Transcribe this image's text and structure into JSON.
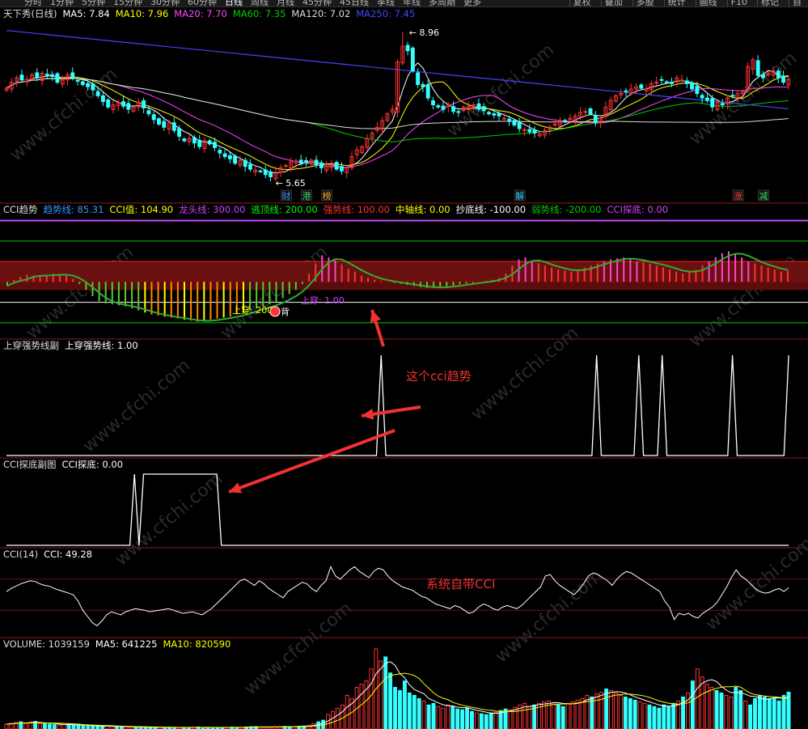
{
  "topbar": {
    "tabs": [
      "分时",
      "1分钟",
      "5分钟",
      "15分钟",
      "30分钟",
      "60分钟",
      "日线",
      "周线",
      "月线",
      "45分钟",
      "45日线",
      "季线",
      "年线",
      "多周期",
      "更多"
    ],
    "active_tab": "日线",
    "tools": [
      "复权",
      "叠加",
      "多股",
      "统计",
      "画线",
      "F10",
      "标记",
      "自"
    ]
  },
  "panels": {
    "main": {
      "header": [
        {
          "text": "天下秀(日线)",
          "color": "#dddddd"
        },
        {
          "text": "MA5: 7.84",
          "color": "#ffffff"
        },
        {
          "text": "MA10: 7.96",
          "color": "#ffff00"
        },
        {
          "text": "MA20: 7.70",
          "color": "#ff44ff"
        },
        {
          "text": "MA60: 7.35",
          "color": "#00cc00"
        },
        {
          "text": "MA120: 7.02",
          "color": "#dddddd"
        },
        {
          "text": "MA250: 7.45",
          "color": "#4444ff"
        }
      ],
      "high_label": "8.96",
      "low_label": "5.65",
      "event_markers": [
        {
          "text": "财",
          "color": "#3399ff"
        },
        {
          "text": "港",
          "color": "#33dd66"
        },
        {
          "text": "榜",
          "color": "#ffaa33"
        },
        {
          "text": "解",
          "color": "#33ccff"
        },
        {
          "text": "涨",
          "color": "#ff4444"
        },
        {
          "text": "减",
          "color": "#33dd66"
        }
      ]
    },
    "cci_trend": {
      "header": [
        {
          "text": "CCI趋势",
          "color": "#dddddd"
        },
        {
          "text": "趋势线: 85.31",
          "color": "#3399ff"
        },
        {
          "text": "CCI值: 104.90",
          "color": "#ffff00"
        },
        {
          "text": "龙头线: 300.00",
          "color": "#cc44ff"
        },
        {
          "text": "逃顶线: 200.00",
          "color": "#00ff00"
        },
        {
          "text": "强势线: 100.00",
          "color": "#ff3333"
        },
        {
          "text": "中轴线: 0.00",
          "color": "#ffff00"
        },
        {
          "text": "抄底线: -100.00",
          "color": "#ffffff"
        },
        {
          "text": "弱势线: -200.00",
          "color": "#00cc00"
        },
        {
          "text": "CCI探底: 0.00",
          "color": "#cc44ff"
        }
      ],
      "annotations": [
        "上穿: 200",
        "上穿: 1.00",
        "背"
      ]
    },
    "cross_sub": {
      "header": [
        {
          "text": "上穿强势线副",
          "color": "#dddddd"
        },
        {
          "text": "上穿强势线: 1.00",
          "color": "#ffffff"
        }
      ]
    },
    "bottom_sub": {
      "header": [
        {
          "text": "CCI探底副图",
          "color": "#dddddd"
        },
        {
          "text": "CCI探底: 0.00",
          "color": "#ffffff"
        }
      ]
    },
    "cci14": {
      "header": [
        {
          "text": "CCI(14)",
          "color": "#dddddd"
        },
        {
          "text": "CCI: 49.28",
          "color": "#ffffff"
        }
      ]
    },
    "volume": {
      "header": [
        {
          "text": "VOLUME: 1039159",
          "color": "#dddddd"
        },
        {
          "text": "MA5: 641225",
          "color": "#ffffff"
        },
        {
          "text": "MA10: 820590",
          "color": "#ffff00"
        }
      ]
    }
  },
  "callouts": {
    "trend": "这个cci趋势",
    "builtin": "系统自带CCI"
  },
  "watermark": "www.cfchi.com",
  "colors": {
    "up": "#ff3333",
    "down": "#33ffff",
    "ma5": "#ffffff",
    "ma10": "#ffff00",
    "ma20": "#ff44ff",
    "ma60": "#00cc00",
    "ma120": "#dddddd",
    "ma250": "#4444ff",
    "arrow": "#ee3333"
  },
  "chart_data": [
    {
      "type": "candlestick",
      "title": "天下秀(日线)",
      "ylim": [
        5.4,
        9.3
      ],
      "close": [
        7.72,
        7.85,
        7.95,
        7.9,
        7.92,
        8.02,
        7.95,
        8.05,
        8.0,
        7.98,
        7.85,
        7.9,
        8.02,
        7.95,
        7.88,
        7.8,
        7.75,
        7.68,
        7.55,
        7.42,
        7.3,
        7.35,
        7.4,
        7.32,
        7.25,
        7.3,
        7.4,
        7.28,
        7.15,
        7.02,
        6.92,
        6.85,
        6.95,
        6.78,
        6.65,
        6.55,
        6.6,
        6.5,
        6.42,
        6.55,
        6.48,
        6.4,
        6.28,
        6.2,
        6.15,
        6.05,
        6.12,
        5.98,
        5.92,
        5.9,
        5.88,
        5.8,
        5.75,
        5.85,
        5.95,
        6.0,
        6.08,
        6.1,
        6.05,
        6.08,
        6.12,
        6.02,
        5.95,
        5.98,
        6.05,
        5.92,
        5.88,
        5.95,
        6.2,
        6.35,
        6.42,
        6.6,
        6.72,
        6.85,
        7.0,
        7.15,
        7.25,
        8.3,
        8.65,
        8.55,
        8.1,
        7.8,
        7.75,
        7.5,
        7.35,
        7.3,
        7.25,
        7.35,
        7.2,
        7.18,
        7.3,
        7.32,
        7.35,
        7.25,
        7.22,
        7.15,
        7.12,
        7.1,
        7.05,
        6.98,
        6.9,
        6.82,
        6.8,
        6.75,
        6.72,
        6.7,
        6.78,
        6.85,
        6.92,
        7.0,
        6.98,
        7.05,
        7.1,
        7.18,
        7.2,
        7.15,
        6.95,
        7.05,
        7.3,
        7.45,
        7.55,
        7.6,
        7.65,
        7.7,
        7.75,
        7.72,
        7.7,
        7.82,
        7.85,
        7.9,
        7.85,
        7.82,
        7.95,
        7.9,
        7.82,
        7.7,
        7.6,
        7.5,
        7.45,
        7.3,
        7.4,
        7.35,
        7.5,
        7.55,
        7.6,
        7.65,
        8.2,
        8.35,
        8.0,
        7.95,
        8.05,
        8.1,
        7.95,
        7.85,
        7.92
      ],
      "overlays": [
        "MA5",
        "MA10",
        "MA20",
        "MA60",
        "MA120",
        "MA250"
      ],
      "annotations": {
        "high": 8.96,
        "low": 5.65
      }
    },
    {
      "type": "bar",
      "title": "CCI趋势",
      "reference_lines": {
        "龙头线": 300,
        "逃顶线": 200,
        "强势线": 100,
        "中轴线": 0,
        "抄底线": -100,
        "弱势线": -200
      },
      "ylim": [
        -260,
        330
      ],
      "values": [
        -20,
        10,
        25,
        35,
        30,
        28,
        32,
        40,
        38,
        30,
        15,
        -10,
        -40,
        -70,
        -95,
        -105,
        -110,
        -115,
        -120,
        -130,
        -140,
        -150,
        -160,
        -165,
        -170,
        -175,
        -180,
        -185,
        -190,
        -195,
        -190,
        -185,
        -180,
        -175,
        -170,
        -160,
        -150,
        -140,
        -130,
        -120,
        -110,
        -100,
        -80,
        -60,
        -40,
        -10,
        40,
        90,
        130,
        120,
        105,
        85,
        65,
        50,
        30,
        20,
        10,
        5,
        0,
        -5,
        -10,
        -15,
        -20,
        -25,
        -30,
        -28,
        -26,
        -22,
        -18,
        -12,
        -8,
        -5,
        0,
        5,
        10,
        20,
        40,
        80,
        110,
        120,
        100,
        90,
        80,
        70,
        60,
        55,
        50,
        60,
        70,
        80,
        90,
        100,
        110,
        115,
        120,
        110,
        100,
        95,
        90,
        80,
        70,
        60,
        50,
        40,
        50,
        60,
        80,
        100,
        120,
        140,
        150,
        140,
        120,
        100,
        90,
        80,
        70,
        60,
        50,
        55
      ],
      "up_cross_value": 200
    },
    {
      "type": "line",
      "title": "上穿强势线副",
      "ylim": [
        0,
        1
      ],
      "values": [
        0,
        0,
        0,
        0,
        0,
        0,
        0,
        0,
        0,
        0,
        0,
        0,
        0,
        0,
        0,
        0,
        0,
        0,
        0,
        0,
        0,
        0,
        0,
        0,
        0,
        0,
        0,
        0,
        0,
        0,
        0,
        0,
        0,
        0,
        0,
        0,
        0,
        0,
        0,
        0,
        0,
        0,
        0,
        0,
        0,
        0,
        0,
        0,
        0,
        0,
        0,
        0,
        0,
        0,
        0,
        0,
        0,
        0,
        0,
        0,
        0,
        0,
        0,
        0,
        0,
        0,
        0,
        0,
        0,
        0,
        0,
        0,
        0,
        0,
        0,
        0,
        0,
        0,
        0,
        0,
        1,
        0,
        0,
        0,
        0,
        0,
        0,
        0,
        0,
        0,
        0,
        0,
        0,
        0,
        0,
        0,
        0,
        0,
        0,
        0,
        0,
        0,
        0,
        0,
        0,
        0,
        0,
        0,
        0,
        0,
        0,
        0,
        0,
        0,
        0,
        0,
        0,
        0,
        0,
        0,
        0,
        0,
        0,
        0,
        0,
        0,
        1,
        0,
        0,
        0,
        0,
        0,
        0,
        0,
        0,
        1,
        0,
        0,
        0,
        0,
        1,
        0,
        0,
        0,
        0,
        0,
        0,
        0,
        0,
        0,
        0,
        0,
        0,
        0,
        0,
        1,
        0,
        0,
        0,
        0,
        0,
        0,
        0,
        0,
        0,
        0,
        0,
        1
      ]
    },
    {
      "type": "line",
      "title": "CCI探底副图",
      "ylim": [
        0,
        1
      ],
      "values": [
        0,
        0,
        0,
        0,
        0,
        0,
        0,
        0,
        0,
        0,
        0,
        0,
        0,
        0,
        0,
        0,
        0,
        0,
        0,
        0,
        0,
        0,
        0,
        0,
        0,
        0,
        0,
        0,
        1,
        0,
        1,
        1,
        1,
        1,
        1,
        1,
        1,
        1,
        1,
        1,
        1,
        1,
        1,
        1,
        1,
        1,
        1,
        0,
        0,
        0,
        0,
        0,
        0,
        0,
        0,
        0,
        0,
        0,
        0,
        0,
        0,
        0,
        0,
        0,
        0,
        0,
        0,
        0,
        0,
        0,
        0,
        0,
        0,
        0,
        0,
        0,
        0,
        0,
        0,
        0,
        0,
        0,
        0,
        0,
        0,
        0,
        0,
        0,
        0,
        0,
        0,
        0,
        0,
        0,
        0,
        0,
        0,
        0,
        0,
        0,
        0,
        0,
        0,
        0,
        0,
        0,
        0,
        0,
        0,
        0,
        0,
        0,
        0,
        0,
        0,
        0,
        0,
        0,
        0,
        0,
        0,
        0,
        0,
        0,
        0,
        0,
        0,
        0,
        0,
        0,
        0,
        0,
        0,
        0,
        0,
        0,
        0,
        0,
        0,
        0,
        0,
        0,
        0,
        0,
        0,
        0,
        0,
        0,
        0,
        0,
        0,
        0,
        0,
        0,
        0,
        0,
        0,
        0,
        0,
        0,
        0,
        0,
        0,
        0,
        0,
        0,
        0,
        0,
        0,
        0,
        0,
        0
      ]
    },
    {
      "type": "line",
      "title": "CCI(14)",
      "ylim": [
        -250,
        250
      ],
      "values": [
        20,
        40,
        55,
        70,
        80,
        90,
        85,
        70,
        60,
        55,
        40,
        30,
        20,
        10,
        0,
        -40,
        -100,
        -140,
        -180,
        -200,
        -170,
        -130,
        -110,
        -120,
        -130,
        -110,
        -100,
        -90,
        -95,
        -100,
        -110,
        -105,
        -100,
        -95,
        -90,
        -100,
        -110,
        -120,
        -115,
        -110,
        -120,
        -130,
        -110,
        -90,
        -60,
        -30,
        0,
        30,
        60,
        90,
        100,
        80,
        60,
        90,
        70,
        40,
        20,
        0,
        -20,
        20,
        40,
        60,
        80,
        70,
        40,
        20,
        60,
        90,
        180,
        120,
        100,
        130,
        160,
        180,
        150,
        130,
        110,
        150,
        170,
        160,
        120,
        90,
        70,
        50,
        40,
        30,
        10,
        -10,
        -20,
        -40,
        -60,
        -70,
        -80,
        -90,
        -70,
        -80,
        -100,
        -120,
        -110,
        -80,
        -60,
        -70,
        -90,
        -100,
        -80,
        -70,
        -80,
        -90,
        -70,
        -40,
        -10,
        20,
        50,
        120,
        130,
        90,
        60,
        40,
        20,
        0,
        30,
        70,
        120,
        140,
        130,
        110,
        90,
        60,
        100,
        130,
        150,
        140,
        120,
        100,
        80,
        60,
        40,
        20,
        -40,
        -80,
        -160,
        -120,
        -130,
        -120,
        -140,
        -150,
        -120,
        -100,
        -80,
        -50,
        0,
        50,
        110,
        160,
        120,
        100,
        70,
        40,
        20,
        10,
        15,
        30,
        40,
        20,
        45
      ]
    },
    {
      "type": "bar",
      "title": "VOLUME",
      "values": [
        60,
        70,
        80,
        90,
        70,
        85,
        95,
        70,
        65,
        60,
        55,
        50,
        55,
        60,
        50,
        45,
        40,
        42,
        38,
        35,
        30,
        35,
        32,
        30,
        28,
        26,
        24,
        25,
        22,
        20,
        22,
        24,
        20,
        18,
        20,
        19,
        18,
        17,
        20,
        22,
        25,
        20,
        18,
        17,
        19,
        20,
        22,
        24,
        20,
        22,
        25,
        28,
        30,
        26,
        24,
        22,
        28,
        30,
        32,
        28,
        30,
        35,
        38,
        45,
        70,
        90,
        110,
        180,
        220,
        260,
        300,
        420,
        380,
        520,
        560,
        600,
        750,
        1000,
        850,
        900,
        700,
        520,
        480,
        600,
        450,
        420,
        380,
        350,
        300,
        320,
        280,
        260,
        300,
        280,
        250,
        240,
        260,
        220,
        200,
        190,
        180,
        200,
        210,
        230,
        250,
        240,
        270,
        300,
        320,
        280,
        300,
        320,
        340,
        350,
        330,
        300,
        280,
        320,
        340,
        360,
        380,
        420,
        400,
        440,
        460,
        500,
        480,
        450,
        420,
        400,
        380,
        360,
        340,
        320,
        300,
        280,
        260,
        300,
        280,
        320,
        350,
        400,
        450,
        600,
        750,
        650,
        560,
        520,
        480,
        450,
        420,
        400,
        520,
        480,
        350,
        300,
        380,
        420,
        400,
        380,
        380,
        350,
        420,
        460
      ]
    }
  ]
}
